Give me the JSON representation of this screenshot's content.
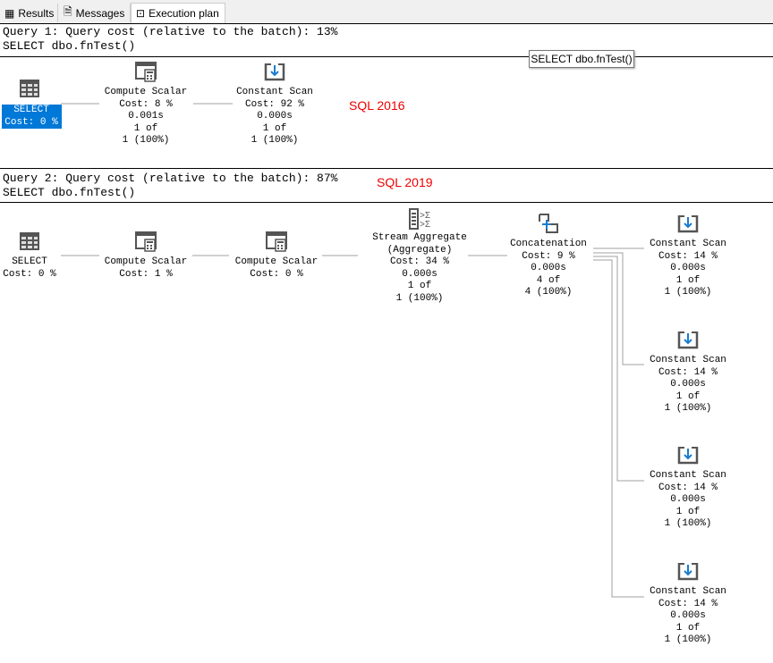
{
  "tabs": [
    {
      "label": "Results",
      "icon": "grid-icon"
    },
    {
      "label": "Messages",
      "icon": "messages-icon"
    },
    {
      "label": "Execution plan",
      "icon": "plan-icon",
      "active": true
    }
  ],
  "query1": {
    "header": "Query 1: Query cost (relative to the batch): 13%",
    "sql": "SELECT dbo.fnTest()",
    "annotation": "SQL 2016",
    "tooltip": "SELECT dbo.fnTest()",
    "nodes": [
      {
        "kind": "select",
        "lines": [
          "SELECT",
          "Cost: 0 %"
        ],
        "selected": true
      },
      {
        "kind": "compute",
        "lines": [
          "Compute Scalar",
          "Cost: 8 %",
          "0.001s",
          "1 of",
          "1 (100%)"
        ]
      },
      {
        "kind": "scan",
        "lines": [
          "Constant Scan",
          "Cost: 92 %",
          "0.000s",
          "1 of",
          "1 (100%)"
        ]
      }
    ]
  },
  "query2": {
    "header": "Query 2: Query cost (relative to the batch): 87%",
    "sql": "SELECT dbo.fnTest()",
    "annotation": "SQL 2019",
    "nodes": [
      {
        "kind": "select",
        "lines": [
          "SELECT",
          "Cost: 0 %"
        ]
      },
      {
        "kind": "compute",
        "lines": [
          "Compute Scalar",
          "Cost: 1 %"
        ]
      },
      {
        "kind": "compute",
        "lines": [
          "Compute Scalar",
          "Cost: 0 %"
        ]
      },
      {
        "kind": "aggregate",
        "lines": [
          "Stream Aggregate",
          "(Aggregate)",
          "Cost: 34 %",
          "0.000s",
          "1 of",
          "1 (100%)"
        ]
      },
      {
        "kind": "concat",
        "lines": [
          "Concatenation",
          "Cost: 9 %",
          "0.000s",
          "4 of",
          "4 (100%)"
        ]
      },
      {
        "kind": "scan",
        "lines": [
          "Constant Scan",
          "Cost: 14 %",
          "0.000s",
          "1 of",
          "1 (100%)"
        ]
      },
      {
        "kind": "scan",
        "lines": [
          "Constant Scan",
          "Cost: 14 %",
          "0.000s",
          "1 of",
          "1 (100%)"
        ]
      },
      {
        "kind": "scan",
        "lines": [
          "Constant Scan",
          "Cost: 14 %",
          "0.000s",
          "1 of",
          "1 (100%)"
        ]
      },
      {
        "kind": "scan",
        "lines": [
          "Constant Scan",
          "Cost: 14 %",
          "0.000s",
          "1 of",
          "1 (100%)"
        ]
      }
    ]
  },
  "colors": {
    "selected": "#0078d7",
    "annotation": "#e00000",
    "connector": "#a0a0a0"
  }
}
